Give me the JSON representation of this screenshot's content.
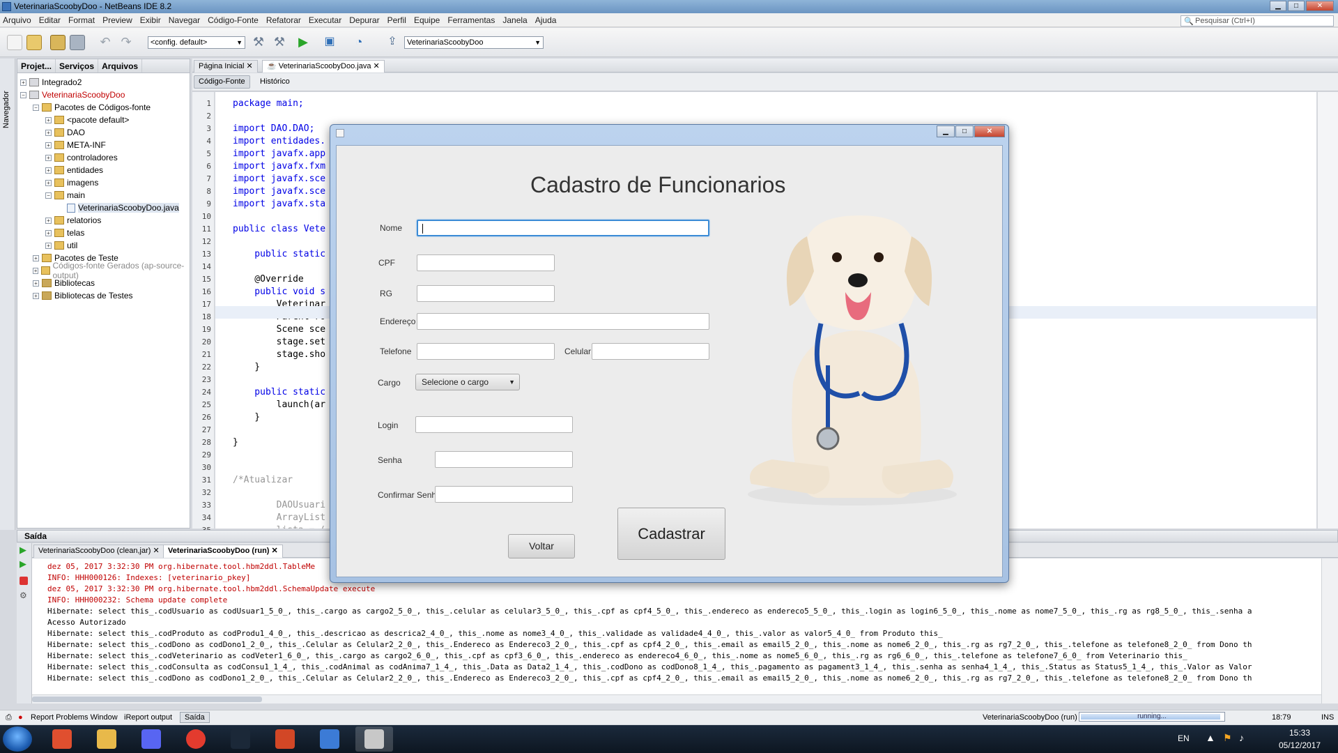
{
  "window": {
    "title": "VeterinariaScoobyDoo - NetBeans IDE 8.2",
    "min": "▁",
    "max": "□",
    "close": "✕"
  },
  "menu": [
    "Arquivo",
    "Editar",
    "Format",
    "Preview",
    "Exibir",
    "Navegar",
    "Código-Fonte",
    "Refatorar",
    "Executar",
    "Depurar",
    "Perfil",
    "Equipe",
    "Ferramentas",
    "Janela",
    "Ajuda"
  ],
  "search": {
    "placeholder": "Pesquisar (Ctrl+I)",
    "icon": "search-icon"
  },
  "toolbar": {
    "config": "<config. default>",
    "project": "VeterinariaScoobyDoo"
  },
  "leftstrip": {
    "label": "Navegador"
  },
  "projects": {
    "tabs": [
      "Projet...",
      "Serviços",
      "Arquivos"
    ],
    "tree": [
      {
        "label": "Integrado2",
        "icon": "project-icon"
      },
      {
        "label": "VeterinariaScoobyDoo",
        "icon": "project-icon"
      },
      {
        "label": "Pacotes de Códigos-fonte",
        "icon": "folder-icon"
      },
      {
        "label": "<pacote default>",
        "icon": "package-icon"
      },
      {
        "label": "DAO",
        "icon": "package-icon"
      },
      {
        "label": "META-INF",
        "icon": "package-icon"
      },
      {
        "label": "controladores",
        "icon": "package-icon"
      },
      {
        "label": "entidades",
        "icon": "package-icon"
      },
      {
        "label": "imagens",
        "icon": "package-icon"
      },
      {
        "label": "main",
        "icon": "package-icon"
      },
      {
        "label": "VeterinariaScoobyDoo.java",
        "icon": "java-file-icon"
      },
      {
        "label": "relatorios",
        "icon": "package-icon"
      },
      {
        "label": "telas",
        "icon": "package-icon"
      },
      {
        "label": "util",
        "icon": "package-icon"
      },
      {
        "label": "Pacotes de Teste",
        "icon": "folder-icon"
      },
      {
        "label": "Códigos-fonte Gerados (ap-source-output)",
        "icon": "folder-icon"
      },
      {
        "label": "Bibliotecas",
        "icon": "library-icon"
      },
      {
        "label": "Bibliotecas de Testes",
        "icon": "library-icon"
      }
    ]
  },
  "editor": {
    "tabs": [
      "Página Inicial",
      "VeterinariaScoobyDoo.java"
    ],
    "modes": [
      "Código-Fonte",
      "Histórico"
    ],
    "lines": [
      {
        "n": "1",
        "t": "package main;"
      },
      {
        "n": "2",
        "t": ""
      },
      {
        "n": "3",
        "t": "import DAO.DAO;"
      },
      {
        "n": "4",
        "t": "import entidades."
      },
      {
        "n": "5",
        "t": "import javafx.app"
      },
      {
        "n": "6",
        "t": "import javafx.fxm"
      },
      {
        "n": "7",
        "t": "import javafx.sce"
      },
      {
        "n": "8",
        "t": "import javafx.sce"
      },
      {
        "n": "9",
        "t": "import javafx.sta"
      },
      {
        "n": "10",
        "t": ""
      },
      {
        "n": "11",
        "t": "public class Vete"
      },
      {
        "n": "12",
        "t": ""
      },
      {
        "n": "13",
        "t": "    public static"
      },
      {
        "n": "14",
        "t": ""
      },
      {
        "n": "15",
        "t": "    @Override"
      },
      {
        "n": "16",
        "t": "    public void s"
      },
      {
        "n": "17",
        "t": "        Veterinar"
      },
      {
        "n": "18",
        "t": "        Parent ro"
      },
      {
        "n": "19",
        "t": "        Scene sce"
      },
      {
        "n": "20",
        "t": "        stage.set"
      },
      {
        "n": "21",
        "t": "        stage.sho"
      },
      {
        "n": "22",
        "t": "    }"
      },
      {
        "n": "23",
        "t": ""
      },
      {
        "n": "24",
        "t": "    public static"
      },
      {
        "n": "25",
        "t": "        launch(ar"
      },
      {
        "n": "26",
        "t": "    }"
      },
      {
        "n": "27",
        "t": ""
      },
      {
        "n": "28",
        "t": "}"
      },
      {
        "n": "29",
        "t": ""
      },
      {
        "n": "30",
        "t": ""
      },
      {
        "n": "31",
        "t": "/*Atualizar"
      },
      {
        "n": "32",
        "t": ""
      },
      {
        "n": "33",
        "t": "        DAOUsuari"
      },
      {
        "n": "34",
        "t": "        ArrayList"
      },
      {
        "n": "35",
        "t": "        lista = ("
      }
    ]
  },
  "output": {
    "title": "Saída",
    "tabs": [
      "VeterinariaScoobyDoo (clean,jar)",
      "VeterinariaScoobyDoo (run)"
    ],
    "lines": [
      {
        "t": "dez 05, 2017 3:32:30 PM org.hibernate.tool.hbm2ddl.TableMe",
        "red": true
      },
      {
        "t": "INFO: HHH000126: Indexes: [veterinario_pkey]",
        "red": true
      },
      {
        "t": "dez 05, 2017 3:32:30 PM org.hibernate.tool.hbm2ddl.SchemaUpdate execute",
        "red": true
      },
      {
        "t": "INFO: HHH000232: Schema update complete",
        "red": true
      },
      {
        "t": "Hibernate: select this_.codUsuario as codUsuar1_5_0_, this_.cargo as cargo2_5_0_, this_.celular as celular3_5_0_, this_.cpf as cpf4_5_0_, this_.endereco as endereco5_5_0_, this_.login as login6_5_0_, this_.nome as nome7_5_0_, this_.rg as rg8_5_0_, this_.senha a",
        "red": false
      },
      {
        "t": "Acesso Autorizado",
        "red": false
      },
      {
        "t": "Hibernate: select this_.codProduto as codProdu1_4_0_, this_.descricao as descrica2_4_0_, this_.nome as nome3_4_0_, this_.validade as validade4_4_0_, this_.valor as valor5_4_0_ from Produto this_",
        "red": false
      },
      {
        "t": "Hibernate: select this_.codDono as codDono1_2_0_, this_.Celular as Celular2_2_0_, this_.Endereco as Endereco3_2_0_, this_.cpf as cpf4_2_0_, this_.email as email5_2_0_, this_.nome as nome6_2_0_, this_.rg as rg7_2_0_, this_.telefone as telefone8_2_0_ from Dono th",
        "red": false
      },
      {
        "t": "Hibernate: select this_.codVeterinario as codVeter1_6_0_, this_.cargo as cargo2_6_0_, this_.cpf as cpf3_6_0_, this_.endereco as endereco4_6_0_, this_.nome as nome5_6_0_, this_.rg as rg6_6_0_, this_.telefone as telefone7_6_0_ from Veterinario this_",
        "red": false
      },
      {
        "t": "Hibernate: select this_.codConsulta as codConsu1_1_4_, this_.codAnimal as codAnima7_1_4_, this_.Data as Data2_1_4_, this_.codDono as codDono8_1_4_, this_.pagamento as pagament3_1_4_, this_.senha as senha4_1_4_, this_.Status as Status5_1_4_, this_.Valor as Valor",
        "red": false
      },
      {
        "t": "Hibernate: select this_.codDono as codDono1_2_0_, this_.Celular as Celular2_2_0_, this_.Endereco as Endereco3_2_0_, this_.cpf as cpf4_2_0_, this_.email as email5_2_0_, this_.nome as nome6_2_0_, this_.rg as rg7_2_0_, this_.telefone as telefone8_2_0_ from Dono th",
        "red": false
      }
    ]
  },
  "status": {
    "items": [
      "Report Problems Window",
      "iReport output",
      "Saída"
    ],
    "project": "VeterinariaScoobyDoo (run)",
    "progress_text": "running...",
    "position": "18:79",
    "mode": "INS"
  },
  "taskbar": {
    "lang": "EN",
    "time": "15:33",
    "date": "05/12/2017",
    "apps": [
      "explorer-icon",
      "files-icon",
      "discord-icon",
      "chrome-icon",
      "steam-icon",
      "office-icon",
      "virtualbox-icon",
      "java-icon"
    ]
  },
  "dialog": {
    "title": "",
    "heading": "Cadastro de Funcionarios",
    "labels": {
      "nome": "Nome",
      "cpf": "CPF",
      "rg": "RG",
      "endereco": "Endereço",
      "telefone": "Telefone",
      "celular": "Celular",
      "cargo": "Cargo",
      "login": "Login",
      "senha": "Senha",
      "confirmar": "Confirmar Senha"
    },
    "cargo_value": "Selecione o cargo",
    "buttons": {
      "voltar": "Voltar",
      "cadastrar": "Cadastrar"
    },
    "colors": {
      "focus": "#3b8bd6",
      "stethoscope": "#1f4fa8"
    }
  }
}
